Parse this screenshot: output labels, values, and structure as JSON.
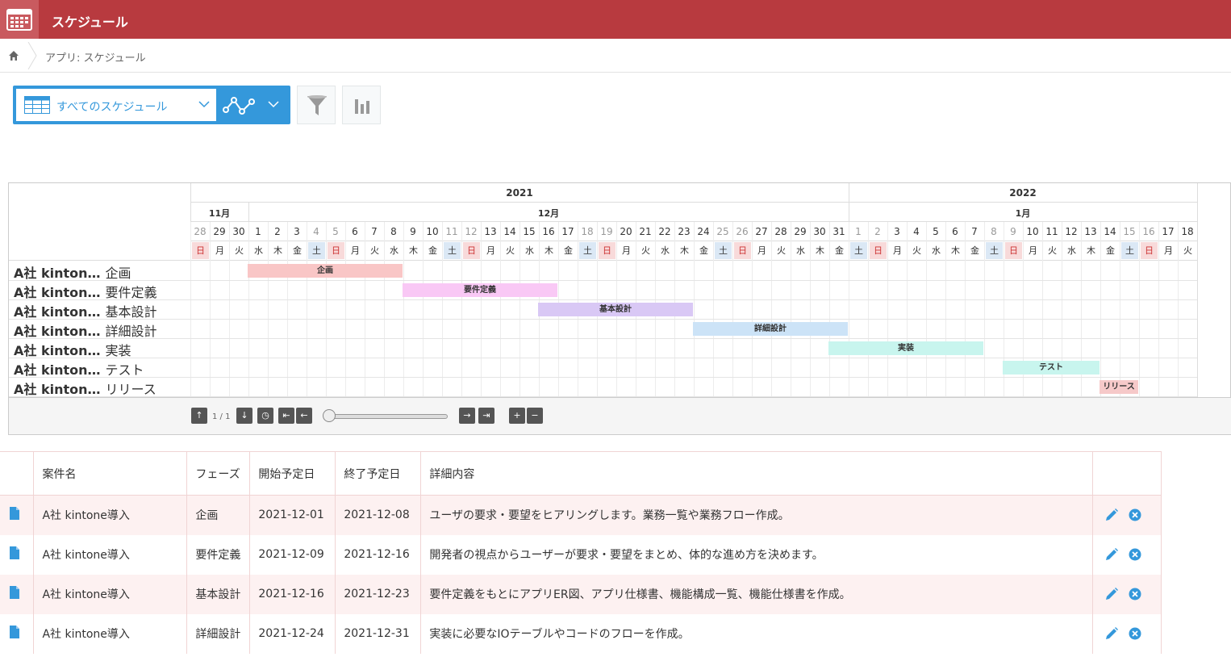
{
  "header": {
    "title": "スケジュール"
  },
  "breadcrumb": {
    "text": "アプリ: スケジュール"
  },
  "toolbar": {
    "view_label": "すべてのスケジュール"
  },
  "gantt": {
    "years": [
      {
        "label": "2021"
      },
      {
        "label": "2022"
      }
    ],
    "months": [
      {
        "label": "11月"
      },
      {
        "label": "12月"
      },
      {
        "label": "1月"
      }
    ],
    "days": [
      "28",
      "29",
      "30",
      "1",
      "2",
      "3",
      "4",
      "5",
      "6",
      "7",
      "8",
      "9",
      "10",
      "11",
      "12",
      "13",
      "14",
      "15",
      "16",
      "17",
      "18",
      "19",
      "20",
      "21",
      "22",
      "23",
      "24",
      "25",
      "26",
      "27",
      "28",
      "29",
      "30",
      "31",
      "1",
      "2",
      "3",
      "4",
      "5",
      "6",
      "7",
      "8",
      "9",
      "10",
      "11",
      "12",
      "13",
      "14",
      "15",
      "16",
      "17",
      "18"
    ],
    "weekdays": [
      "日",
      "月",
      "火",
      "水",
      "木",
      "金",
      "土",
      "日",
      "月",
      "火",
      "水",
      "木",
      "金",
      "土",
      "日",
      "月",
      "火",
      "水",
      "木",
      "金",
      "土",
      "日",
      "月",
      "火",
      "水",
      "木",
      "金",
      "土",
      "日",
      "月",
      "火",
      "水",
      "木",
      "金",
      "土",
      "日",
      "月",
      "火",
      "水",
      "木",
      "金",
      "土",
      "日",
      "月",
      "火",
      "水",
      "木",
      "金",
      "土",
      "日",
      "月",
      "火"
    ],
    "rows": [
      {
        "project": "A社 kinton…",
        "phase": "企画",
        "bar_label": "企画",
        "color": "#f9c6c6"
      },
      {
        "project": "A社 kinton…",
        "phase": "要件定義",
        "bar_label": "要件定義",
        "color": "#f9c8f5"
      },
      {
        "project": "A社 kinton…",
        "phase": "基本設計",
        "bar_label": "基本設計",
        "color": "#d9c8f5"
      },
      {
        "project": "A社 kinton…",
        "phase": "詳細設計",
        "bar_label": "詳細設計",
        "color": "#cce3f7"
      },
      {
        "project": "A社 kinton…",
        "phase": "実装",
        "bar_label": "実装",
        "color": "#c8f5ee"
      },
      {
        "project": "A社 kinton…",
        "phase": "テスト",
        "bar_label": "テスト",
        "color": "#c8f5ee"
      },
      {
        "project": "A社 kinton…",
        "phase": "リリース",
        "bar_label": "リリース",
        "color": "#f6c9c9"
      }
    ],
    "page_indicator": "1 / 1"
  },
  "table": {
    "headers": {
      "name": "案件名",
      "phase": "フェーズ",
      "start": "開始予定日",
      "end": "終了予定日",
      "detail": "詳細内容"
    },
    "rows": [
      {
        "name": "A社 kintone導入",
        "phase": "企画",
        "start": "2021-12-01",
        "end": "2021-12-08",
        "detail": "ユーザの要求・要望をヒアリングします。業務一覧や業務フロー作成。"
      },
      {
        "name": "A社 kintone導入",
        "phase": "要件定義",
        "start": "2021-12-09",
        "end": "2021-12-16",
        "detail": "開発者の視点からユーザーが要求・要望をまとめ、体的な進め方を決めます。"
      },
      {
        "name": "A社 kintone導入",
        "phase": "基本設計",
        "start": "2021-12-16",
        "end": "2021-12-23",
        "detail": "要件定義をもとにアプリER図、アプリ仕様書、機能構成一覧、機能仕様書を作成。"
      },
      {
        "name": "A社 kintone導入",
        "phase": "詳細設計",
        "start": "2021-12-24",
        "end": "2021-12-31",
        "detail": "実装に必要なIOテーブルやコードのフローを作成。"
      }
    ]
  },
  "colors": {
    "header": "#b83a3f",
    "accent": "#3498db"
  }
}
